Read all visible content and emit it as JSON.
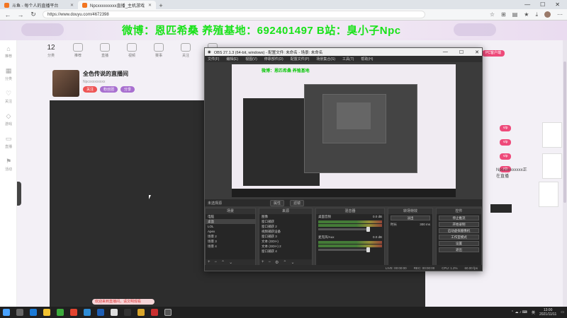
{
  "browser": {
    "tabs": [
      {
        "title": "斗鱼 - 每个人的直播平台",
        "active": false
      },
      {
        "title": "Npcxxxxxxxxx直播_主机游戏",
        "active": true
      }
    ],
    "url": "https://www.douyu.com/4672398"
  },
  "site": {
    "banner_text": "微博：恩匹希桑 养殖基地：692401497 B站：臭小子Npc",
    "topnav": [
      {
        "value": "12",
        "label": "分类"
      },
      {
        "value": "",
        "label": "推荐"
      },
      {
        "value": "",
        "label": "直播"
      },
      {
        "value": "",
        "label": "视频"
      },
      {
        "value": "",
        "label": "赛事"
      },
      {
        "value": "",
        "label": "关注"
      },
      {
        "value": "",
        "label": "历史"
      }
    ],
    "rail": [
      "推荐",
      "分类",
      "关注",
      "游戏",
      "直播",
      "活动"
    ],
    "streamer": {
      "title": "全色传说的直播间",
      "name": "Npcxxxxxxxxx",
      "tags": [
        "关注",
        "粉丝团",
        "分享"
      ]
    },
    "danmu": "欢迎来到直播间，请文明观看",
    "right": {
      "badges": [
        "PC客户端",
        "vip",
        "vip",
        "vip",
        "vip"
      ],
      "text": "Npcxxxxxxxxx正在直播"
    }
  },
  "obs": {
    "title": "OBS 27.1.3 (64-bit, windows) - 配置文件: 未命名 - 场景: 未命名",
    "menu": [
      "文件(F)",
      "编辑(E)",
      "视图(V)",
      "停靠部件(D)",
      "配置文件(P)",
      "场景集合(S)",
      "工具(T)",
      "帮助(H)"
    ],
    "preview_text": "微博：恩匹希桑 养殖基地",
    "transition_label": "未选择源",
    "transition_buttons": [
      "属性",
      "滤镜"
    ],
    "docks": {
      "scenes": {
        "title": "场景",
        "items": [
          "电脑",
          "桌面",
          "LOL",
          "Apex",
          "场景 2",
          "场景 3",
          "场景 4"
        ]
      },
      "sources": {
        "title": "来源",
        "items": [
          "图像",
          "窗口捕获",
          "窗口捕获 2",
          "视频捕获设备",
          "窗口捕获 3",
          "文本 (GDI+)",
          "文本 (GDI+) 2",
          "窗口捕获 4",
          "文本 (GDI+) 3"
        ]
      },
      "mixer": {
        "title": "混音器",
        "channels": [
          {
            "name": "桌面音频",
            "db": "0.0 dB"
          },
          {
            "name": "麦克风/Aux",
            "db": "0.0 dB"
          }
        ]
      },
      "transitions": {
        "title": "转场特效",
        "mode": "淡出",
        "duration_label": "时长",
        "duration": "300 ms"
      },
      "controls": {
        "title": "控件",
        "buttons": [
          "停止推流",
          "开始录制",
          "启动虚拟摄像机",
          "工作室模式",
          "设置",
          "退出"
        ]
      }
    },
    "status": [
      "LIVE: 00:00:00",
      "REC: 00:00:00",
      "CPU: 1.2%",
      "60.00 fps"
    ]
  },
  "taskbar": {
    "time": "13:00",
    "date": "2021/11/11",
    "lang": "英"
  }
}
